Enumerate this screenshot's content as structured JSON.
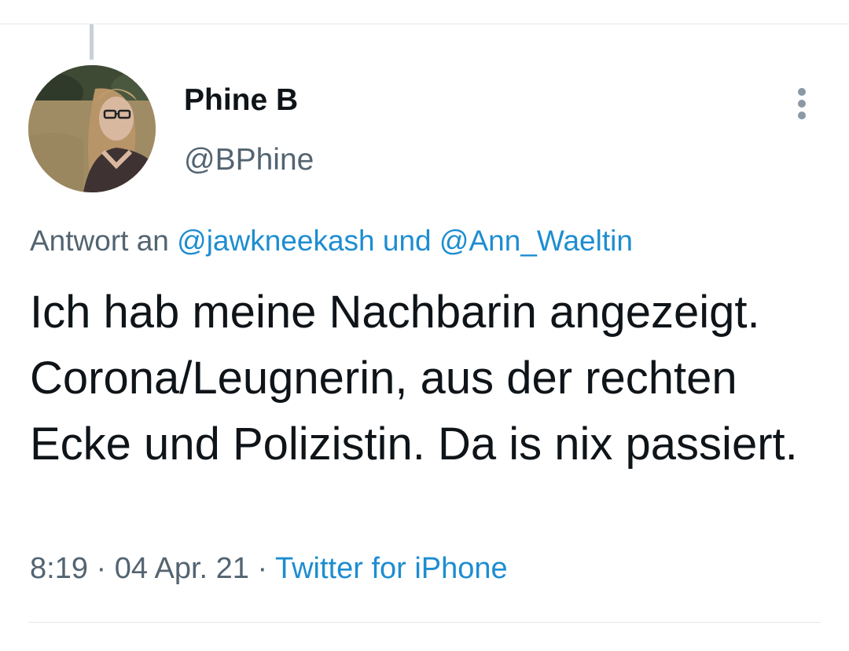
{
  "tweet": {
    "author": {
      "display_name": "Phine B",
      "handle": "@BPhine",
      "avatar_icon": "profile-photo"
    },
    "reply_context": {
      "prefix": "Antwort an",
      "mention_1": "@jawkneekash",
      "joiner": "und",
      "mention_2": "@Ann_Waeltin"
    },
    "text": "Ich hab meine Nachbarin angezeigt. Corona/Leugnerin, aus der rechten Ecke und Polizistin. Da is nix passiert.",
    "time": "8:19",
    "separator": "·",
    "date": "04 Apr. 21",
    "source": "Twitter for iPhone",
    "menu_icon": "more-vertical-icon"
  },
  "colors": {
    "text": "#0f1419",
    "secondary": "#536471",
    "link": "#1d8dd1",
    "border": "#e3e8ec"
  }
}
